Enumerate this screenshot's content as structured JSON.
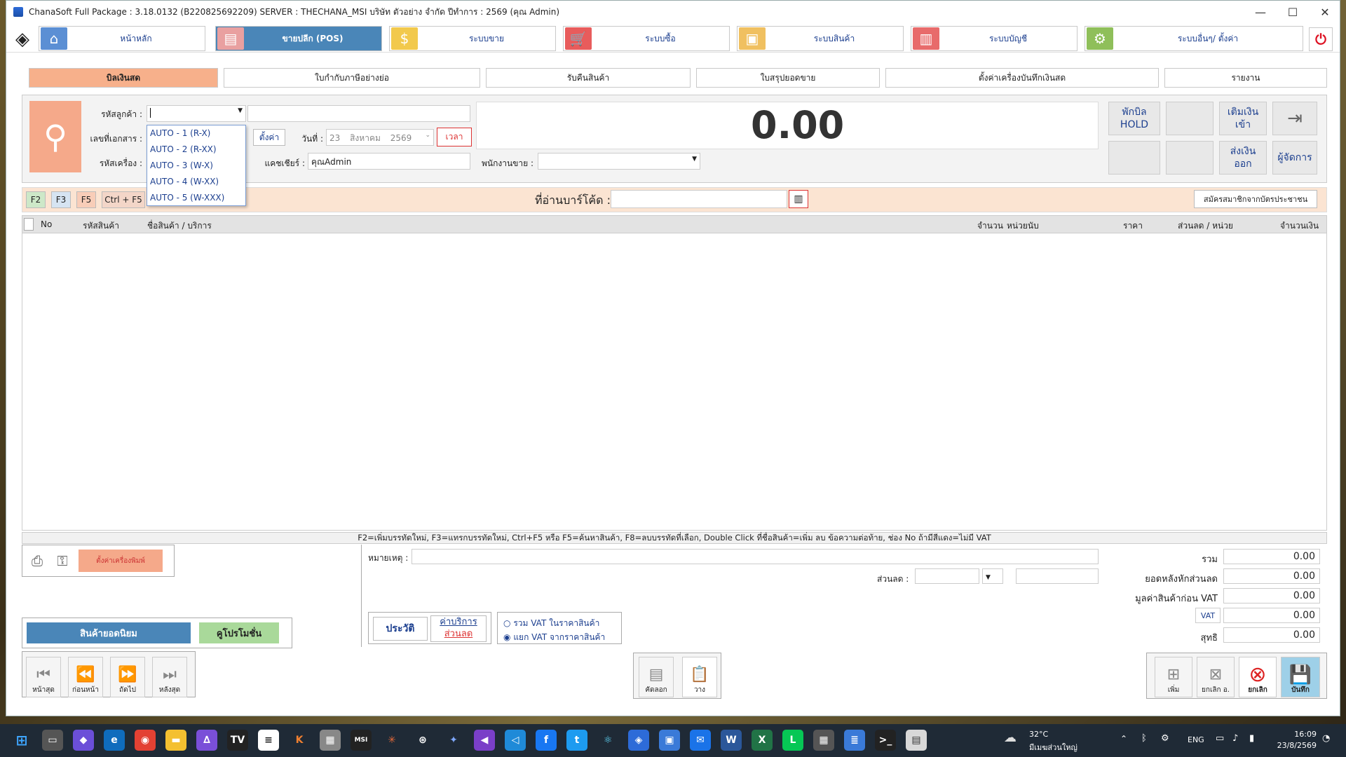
{
  "window": {
    "title": "ChanaSoft Full Package : 3.18.0132 (B220825692209) SERVER : THECHANA_MSI บริษัท ตัวอย่าง จำกัด ปีทำการ : 2569 (คุณ Admin)",
    "min": "—",
    "max": "☐",
    "close": "✕"
  },
  "nav": [
    {
      "label": "หน้าหลัก",
      "icon": "home-icon",
      "glyph": "⌂",
      "color": "#5b8fd4"
    },
    {
      "label": "ขายปลีก (POS)",
      "icon": "pos-terminal-icon",
      "glyph": "▤",
      "color": "#e9a0a0"
    },
    {
      "label": "ระบบขาย",
      "icon": "coin-icon",
      "glyph": "$",
      "color": "#f2c94c"
    },
    {
      "label": "ระบบซื้อ",
      "icon": "cart-icon",
      "glyph": "🛒",
      "color": "#e85c5c"
    },
    {
      "label": "ระบบสินค้า",
      "icon": "box-icon",
      "glyph": "▣",
      "color": "#f0c060"
    },
    {
      "label": "ระบบบัญชี",
      "icon": "report-icon",
      "glyph": "▥",
      "color": "#e86b6b"
    },
    {
      "label": "ระบบอื่นๆ/ ตั้งค่า",
      "icon": "gear-icon",
      "glyph": "⚙",
      "color": "#8fbf5a"
    }
  ],
  "tabs": [
    "บิลเงินสด",
    "ใบกำกับภาษีอย่างย่อ",
    "รับคืนสินค้า",
    "ใบสรุปยอดขาย",
    "ตั้งค่าเครื่องบันทึกเงินสด",
    "รายงาน"
  ],
  "form": {
    "customer_label": "รหัสลูกค้า :",
    "doc_label": "เลขที่เอกสาร :",
    "machine_label": "รหัสเครื่อง :",
    "setting_btn": "ตั้งค่า",
    "date_label": "วันที่ :",
    "date_day": "23",
    "date_month": "สิงหาคม",
    "date_year": "2569",
    "time_btn": "เวลา",
    "cashier_label": "แคชเชียร์ :",
    "cashier_value": "คุณAdmin",
    "salesperson_label": "พนักงานขาย :"
  },
  "total": "0.00",
  "right_buttons": {
    "hold": "พักบิล\nHOLD",
    "add_cash": "เติมเงิน\nเข้า",
    "send_cash": "ส่งเงิน\nออก",
    "manager": "ผู้จัดการ"
  },
  "dropdown": [
    "AUTO - 1 (R-X)",
    "AUTO - 2 (R-XX)",
    "AUTO - 3 (W-X)",
    "AUTO - 4 (W-XX)",
    "AUTO - 5 (W-XXX)"
  ],
  "fkeys": [
    "F2",
    "F3",
    "F5",
    "Ctrl + F5"
  ],
  "barcode_label": "ที่อ่านบาร์โค้ด :",
  "member_btn": "สมัครสมาชิกจากบัตรประชาชน",
  "grid_headers": {
    "no": "No",
    "code": "รหัสสินค้า",
    "name": "ชื่อสินค้า / บริการ",
    "qty": "จำนวน",
    "unit": "หน่วยนับ",
    "price": "ราคา",
    "discount": "ส่วนลด / หน่วย",
    "amount": "จำนวนเงิน"
  },
  "hint": "F2=เพิ่มบรรทัดใหม่,   F3=แทรกบรรทัดใหม่,   Ctrl+F5 หรือ F5=ค้นหาสินค้า,   F8=ลบบรรทัดที่เลือก,   Double Click ที่ชื่อสินค้า=เพิ่ม ลบ ข้อความต่อท้าย,   ช่อง No ถ้ามีสีแดง=ไม่มี VAT",
  "printer_btn": "ตั้งค่าเครื่องพิมพ์",
  "popular_btn": "สินค้ายอดนิยม",
  "coupon_btn": "คูโปรโมชั่น",
  "nav_buttons": [
    "หน้าสุด",
    "ก่อนหน้า",
    "ถัดไป",
    "หลังสุด"
  ],
  "remark_label": "หมายเหตุ :",
  "discount_label": "ส่วนลด :",
  "history_btn": "ประวัติ",
  "service_btn": "ค่าบริการ",
  "discount_btn": "ส่วนลด",
  "vat_options": [
    "รวม VAT ในราคาสินค้า",
    "แยก VAT จากราคาสินค้า"
  ],
  "copy_btn": "คัดลอก",
  "paste_btn": "วาง",
  "summary": [
    {
      "label": "รวม",
      "value": "0.00"
    },
    {
      "label": "ยอดหลังหักส่วนลด",
      "value": "0.00"
    },
    {
      "label": "มูลค่าสินค้าก่อน VAT",
      "value": "0.00"
    },
    {
      "label": "VAT",
      "value": "0.00"
    },
    {
      "label": "สุทธิ",
      "value": "0.00"
    }
  ],
  "actions": [
    "เพิ่ม",
    "ยกเลิก อ.",
    "ยกเลิก",
    "บันทึก"
  ],
  "taskbar": {
    "weather_temp": "32°C",
    "weather_desc": "มีเมฆส่วนใหญ่",
    "lang": "ENG",
    "time": "16:09",
    "date": "23/8/2569"
  }
}
